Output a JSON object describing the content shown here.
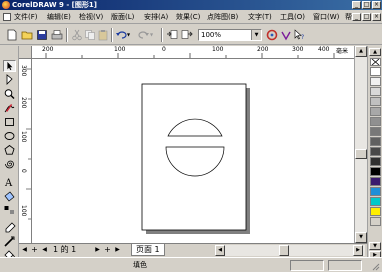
{
  "window": {
    "title": "CorelDRAW 9 - [图形1]",
    "controls": [
      "_",
      "□",
      "×"
    ]
  },
  "menubar": {
    "items": [
      "文件(F)",
      "编辑(E)",
      "检视(V)",
      "版面(L)",
      "安排(A)",
      "效果(C)",
      "点阵图(B)",
      "文字(T)",
      "工具(O)",
      "窗口(W)",
      "帮助(H)"
    ],
    "doc_controls": [
      "_",
      "□",
      "×"
    ]
  },
  "toolbar": {
    "zoom_value": "100%",
    "zoom_arrow": "▼"
  },
  "rulers": {
    "h_labels": [
      "200",
      "100",
      "0",
      "100",
      "200",
      "300",
      "400"
    ],
    "unit": "毫米",
    "v_labels": [
      "300",
      "200",
      "100",
      "0",
      "100"
    ]
  },
  "pagenav": {
    "prev_glyph": "◀",
    "next_glyph": "▶",
    "add_glyph": "+",
    "page_counter": "1 的 1",
    "page_tab": "页面 1"
  },
  "status": {
    "fill_label": "填色"
  },
  "colors": {
    "palette": [
      "#ffffff",
      "#ffffff",
      "#f0f0f0",
      "#d8d8d8",
      "#c0c0c0",
      "#a8a8a8",
      "#909090",
      "#787878",
      "#606060",
      "#484848",
      "#303030",
      "#000000",
      "#3a1a6e",
      "#1e8fd8",
      "#00c9c9",
      "#ffee00"
    ]
  }
}
